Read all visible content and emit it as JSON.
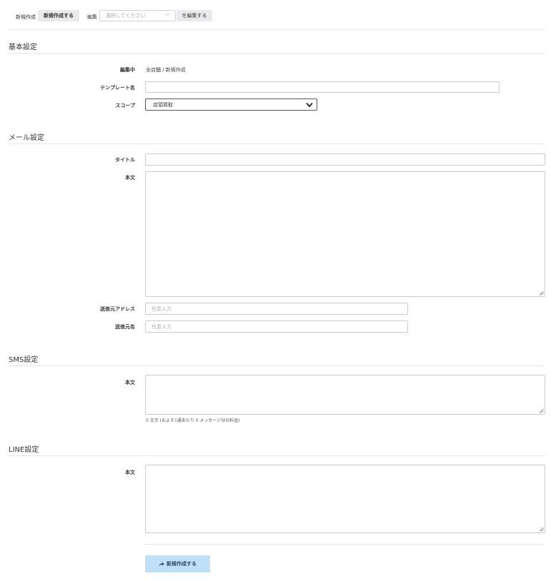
{
  "toolbar": {
    "new_label": "新規作成",
    "new_button": "新規作成する",
    "edit_label": "編集",
    "edit_select_placeholder": "選択してください",
    "edit_button": "を編集する"
  },
  "basic": {
    "title": "基本設定",
    "editing_label": "編集中",
    "editing_value": "全店舗 / 新規作成",
    "template_name_label": "テンプレート名",
    "template_name_value": "",
    "scope_label": "スコープ",
    "scope_value": "店頭買取"
  },
  "mail": {
    "title": "メール設定",
    "subject_label": "タイトル",
    "subject_value": "",
    "body_label": "本文",
    "body_value": "",
    "from_address_label": "送信元アドレス",
    "from_address_placeholder": "任意入力",
    "from_name_label": "送信元名",
    "from_name_placeholder": "任意入力"
  },
  "sms": {
    "title": "SMS設定",
    "body_label": "本文",
    "body_value": "",
    "counter_text": "0 文字 (およそ1通あたり 0 メッセージ分の料金)"
  },
  "line": {
    "title": "LINE設定",
    "body_label": "本文",
    "body_value": ""
  },
  "submit": {
    "label": "新規作成する",
    "icon": "share-icon"
  }
}
